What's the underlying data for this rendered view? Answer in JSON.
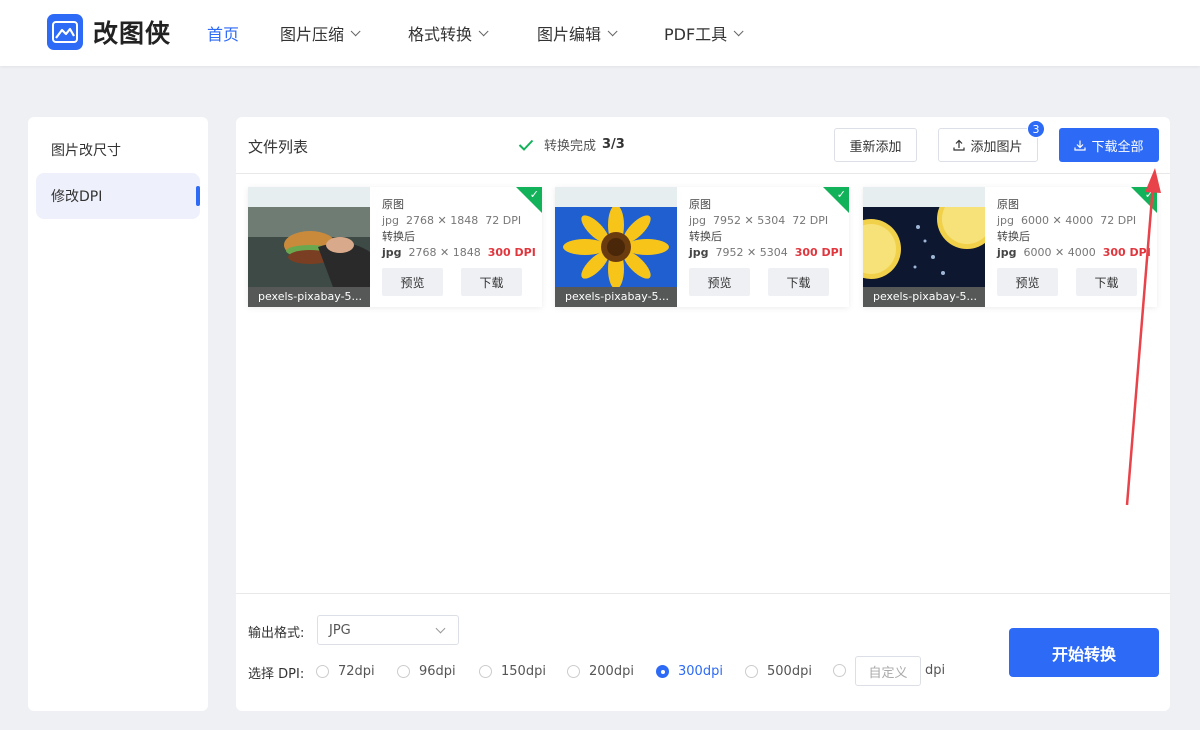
{
  "header": {
    "logo_text": "改图侠",
    "nav": [
      {
        "label": "首页",
        "active": true
      },
      {
        "label": "图片压缩"
      },
      {
        "label": "格式转换"
      },
      {
        "label": "图片编辑"
      },
      {
        "label": "PDF工具"
      }
    ]
  },
  "sidebar": {
    "items": [
      {
        "label": "图片改尺寸"
      },
      {
        "label": "修改DPI",
        "active": true
      }
    ]
  },
  "toolbar": {
    "list_title": "文件列表",
    "status_text": "转换完成",
    "status_count": "3/3",
    "readd_label": "重新添加",
    "add_label": "添加图片",
    "add_badge": "3",
    "download_all_label": "下载全部"
  },
  "files": [
    {
      "filename": "pexels-pixabay-5...",
      "orig_label": "原图",
      "orig_fmt": "jpg",
      "orig_size": "2768 ✕ 1848",
      "orig_dpi": "72 DPI",
      "after_label": "转换后",
      "after_fmt": "jpg",
      "after_size": "2768 ✕ 1848",
      "after_dpi": "300 DPI",
      "preview_label": "预览",
      "download_label": "下载"
    },
    {
      "filename": "pexels-pixabay-5...",
      "orig_label": "原图",
      "orig_fmt": "jpg",
      "orig_size": "7952 ✕ 5304",
      "orig_dpi": "72 DPI",
      "after_label": "转换后",
      "after_fmt": "jpg",
      "after_size": "7952 ✕ 5304",
      "after_dpi": "300 DPI",
      "preview_label": "预览",
      "download_label": "下载"
    },
    {
      "filename": "pexels-pixabay-5...",
      "orig_label": "原图",
      "orig_fmt": "jpg",
      "orig_size": "6000 ✕ 4000",
      "orig_dpi": "72 DPI",
      "after_label": "转换后",
      "after_fmt": "jpg",
      "after_size": "6000 ✕ 4000",
      "after_dpi": "300 DPI",
      "preview_label": "预览",
      "download_label": "下载"
    }
  ],
  "options": {
    "format_label": "输出格式:",
    "format_value": "JPG",
    "dpi_label": "选择 DPI:",
    "dpi_options": [
      "72dpi",
      "96dpi",
      "150dpi",
      "200dpi",
      "300dpi",
      "500dpi"
    ],
    "dpi_selected": "300dpi",
    "custom_placeholder": "自定义",
    "custom_unit": "dpi",
    "start_label": "开始转换"
  },
  "colors": {
    "accent": "#2d6af6",
    "success": "#12b25a",
    "highlight_dpi": "#e0373f",
    "annotation_arrow": "#e8434a"
  }
}
